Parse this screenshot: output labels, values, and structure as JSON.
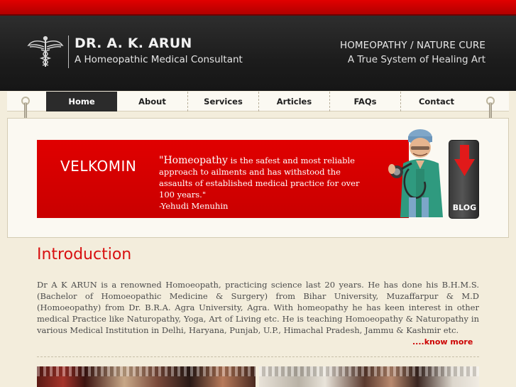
{
  "header": {
    "brand_name": "DR. A. K. ARUN",
    "brand_subtitle": "A Homeopathic Medical Consultant",
    "tagline_1": "HOMEOPATHY / NATURE CURE",
    "tagline_2": "A True System of Healing Art",
    "logo_icon": "caduceus-icon"
  },
  "nav": {
    "items": [
      {
        "label": "Home",
        "active": true
      },
      {
        "label": "About"
      },
      {
        "label": "Services"
      },
      {
        "label": "Articles"
      },
      {
        "label": "FAQs"
      },
      {
        "label": "Contact"
      }
    ]
  },
  "banner": {
    "title": "VELKOMIN",
    "quote_lead": "\"Homeopathy",
    "quote_rest": " is the safest and most reliable approach to ailments and has withstood the assaults of established medical practice for over 100 years.\"",
    "quote_author": "-Yehudi Menuhin",
    "blog_label": "BLOG"
  },
  "intro": {
    "title": "Introduction",
    "text": "Dr A K ARUN is a renowned Homoeopath, practicing science last 20 years. He has done his B.H.M.S. (Bachelor of Homoeopathic Medicine & Surgery) from Bihar University, Muzaffarpur & M.D (Homoeopathy) from Dr. B.R.A. Agra University, Agra. With homeopathy he has keen interest in other medical Practice like Naturopathy, Yoga, Art of Living etc. He is teaching Homoeopathy & Naturopathy in various Medical Institution in Delhi, Haryana, Punjab, U.P., Himachal Pradesh, Jammu & Kashmir etc.",
    "know_more": "....know more"
  },
  "colors": {
    "accent_red": "#d81010",
    "header_dark": "#1c1c1c",
    "page_bg": "#f3eddc"
  }
}
